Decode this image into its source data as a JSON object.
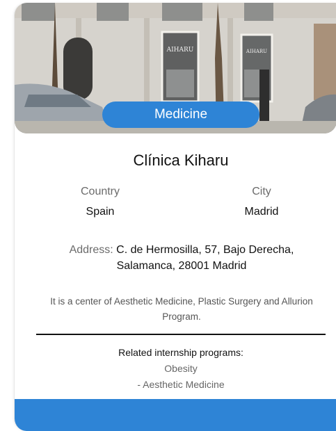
{
  "card": {
    "photo_icon": "building-facade-photo",
    "category": "Medicine",
    "title": "Clínica Kiharu",
    "country_label": "Country",
    "country_value": "Spain",
    "city_label": "City",
    "city_value": "Madrid",
    "address_label": "Address:",
    "address_line1": "C. de Hermosilla, 57, Bajo Derecha,",
    "address_line2": "Salamanca, 28001 Madrid",
    "description": "It is a center of Aesthetic Medicine, Plastic Surgery and Allurion Program.",
    "related_title": "Related internship programs:",
    "related_programs": [
      "Obesity",
      "- Aesthetic Medicine"
    ],
    "sign_text": "AIHARU"
  },
  "colors": {
    "accent": "#2e84d6",
    "text": "#111111",
    "muted": "#6b6b6b"
  }
}
